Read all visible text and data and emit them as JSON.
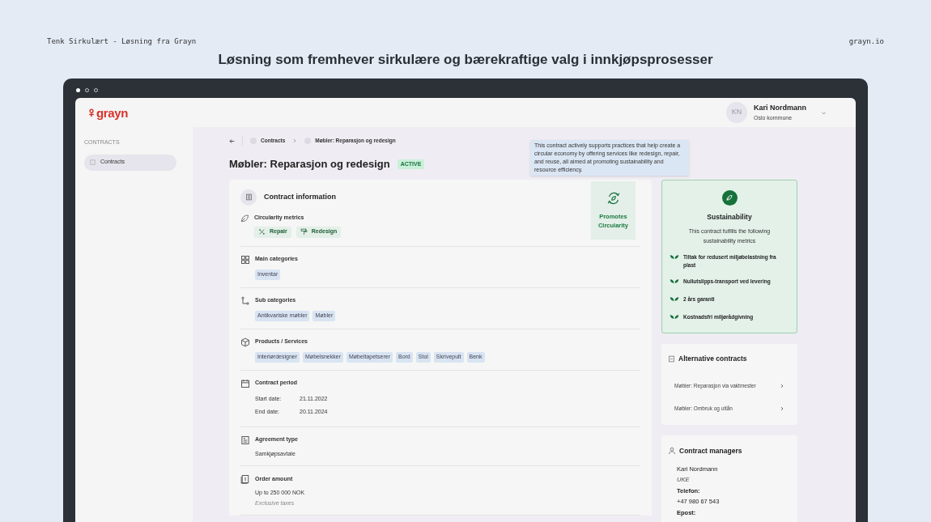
{
  "header": {
    "left": "Tenk Sirkulært - Løsning fra Grayn",
    "title": "Løsning som fremhever sirkulære og bærekraftige valg i innkjøpsprosesser",
    "right": "grayn.io"
  },
  "app": {
    "logo": "grayn",
    "user": {
      "initials": "KN",
      "name": "Kari Nordmann",
      "org": "Oslo kommune"
    },
    "sidebar": {
      "section": "CONTRACTS",
      "items": [
        {
          "label": "Contracts",
          "selected": true
        }
      ]
    },
    "breadcrumb": [
      "Contracts",
      "Møbler: Reparasjon og redesign"
    ],
    "title": "Møbler: Reparasjon og redesign",
    "status": "ACTIVE",
    "tooltip": "This contract actively supports practices that help create a circular economy by offering services like redesign, repair, and reuse, all aimed at promoting sustainability and resource efficiency.",
    "card": {
      "title": "Contract information",
      "promo": "Promotes Circularity",
      "circularity": {
        "label": "Circularity metrics",
        "tags": [
          "Repair",
          "Redesign"
        ]
      },
      "sections": [
        {
          "kind": "tags",
          "label": "Main categories",
          "tags": [
            "Inventar"
          ]
        },
        {
          "kind": "tags",
          "label": "Sub categories",
          "tags": [
            "Antikvariske møbler",
            "Møbler"
          ]
        },
        {
          "kind": "tags",
          "label": "Products / Services",
          "tags": [
            "Interiørdesigner",
            "Møbelsnekker",
            "Møbeltapetserer",
            "Bord",
            "Stol",
            "Skrivepult",
            "Benk"
          ]
        },
        {
          "kind": "dates",
          "label": "Contract period",
          "rows": [
            {
              "label": "Start date:",
              "value": "21.11.2022"
            },
            {
              "label": "End date:",
              "value": "20.11.2024"
            }
          ]
        },
        {
          "kind": "text",
          "label": "Agreement type",
          "value": "Samkjøpsavtale"
        },
        {
          "kind": "text",
          "label": "Order amount",
          "value": "Up to 250 000 NOK",
          "note": "Exclusive taxes"
        }
      ]
    },
    "sustainability": {
      "title": "Sustainability",
      "text": "This contract fulfills the following sustainability metrics",
      "items": [
        "Tiltak for redusert miljøbelastning fra plast",
        "Nullutslipps-transport ved levering",
        "2 års garanti",
        "Kostnadsfri miljørådgivning"
      ]
    },
    "alternatives": {
      "title": "Alternative contracts",
      "items": [
        "Møbler: Reparasjon via vaktmester",
        "Møbler: Ombruk og utlån"
      ]
    },
    "managers": {
      "title": "Contract managers",
      "name": "Kari Nordmann",
      "dept": "UKE",
      "phone_label": "Telefon:",
      "phone": "+47 980 67 543",
      "email_label": "Epost:"
    }
  }
}
